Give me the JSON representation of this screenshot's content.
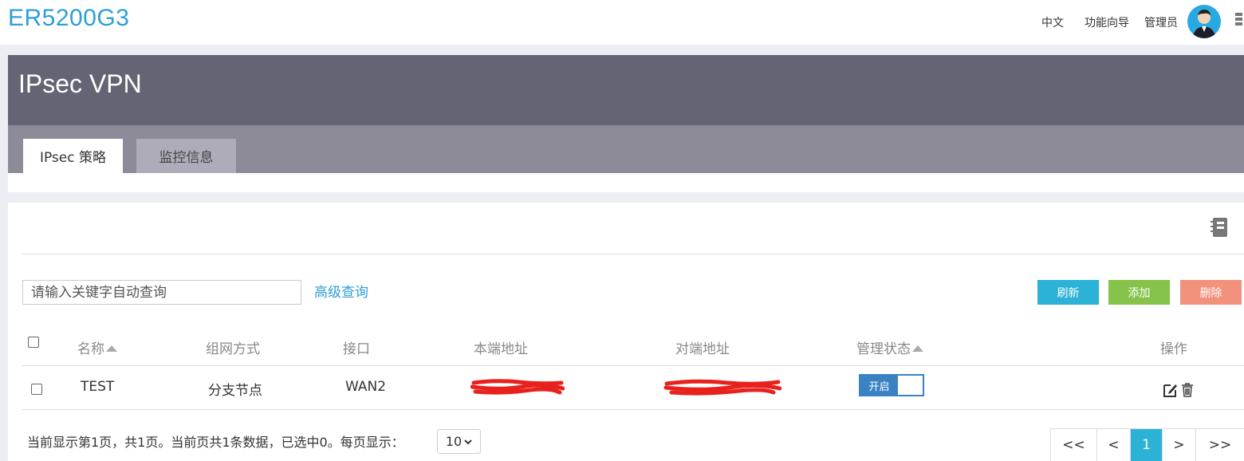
{
  "brand": "ER5200G3",
  "topnav": {
    "language": "中文",
    "wizard": "功能向导",
    "user": "管理员"
  },
  "page": {
    "title": "IPsec VPN"
  },
  "tabs": [
    {
      "label": "IPsec 策略",
      "active": true
    },
    {
      "label": "监控信息",
      "active": false
    }
  ],
  "toolbar": {
    "search_placeholder": "请输入关键字自动查询",
    "advanced_query": "高级查询",
    "refresh": "刷新",
    "add": "添加",
    "delete": "删除"
  },
  "table": {
    "headers": [
      "名称",
      "组网方式",
      "接口",
      "本端地址",
      "对端地址",
      "管理状态",
      "操作"
    ],
    "rows": [
      {
        "name": "TEST",
        "mode": "分支节点",
        "interface": "WAN2",
        "admin_state": "开启"
      }
    ]
  },
  "footer": {
    "summary": "当前显示第1页，共1页。当前页共1条数据，已选中0。每页显示：",
    "page_size": "10",
    "pager": [
      "<<",
      "<",
      "1",
      ">",
      ">>"
    ]
  },
  "colors": {
    "brand": "#2d9fd8",
    "header": "#636575",
    "refresh": "#2cb1d7",
    "add": "#85c34b",
    "delete": "#f2917c",
    "toggle": "#3b82c4"
  }
}
